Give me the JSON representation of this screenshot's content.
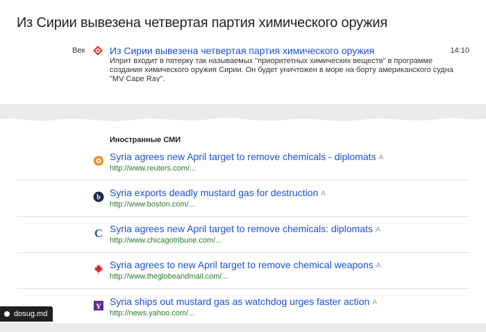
{
  "headline": "Из Сирии вывезена четвертая партия химического оружия",
  "top_item": {
    "source": "Век",
    "source_icon": "red-diamond-icon",
    "title": "Из Сирии вывезена четвертая партия химического оружия",
    "time": "14:10",
    "snippet": "Иприт входит в пятерку так называемых \"приоритетных химических веществ\" в программе создания химического оружия Сирии. Он будет уничтожен в море на борту американского судна \"MV Cape Ray\"."
  },
  "foreign": {
    "section_title": "Иностранные СМИ",
    "translate_label": "A",
    "items": [
      {
        "title": "Syria agrees new April target to remove chemicals - diplomats",
        "url": "http://www.reuters.com/...",
        "icon": "reuters-logo-icon",
        "icon_color": "#f08a24"
      },
      {
        "title": "Syria exports deadly mustard gas for destruction",
        "url": "http://www.boston.com/...",
        "icon": "boston-globe-logo-icon",
        "icon_color": "#1b2a4a"
      },
      {
        "title": "Syria agrees new April target to remove chemicals: diplomats",
        "url": "http://www.chicagotribune.com/...",
        "icon": "chicago-tribune-logo-icon",
        "icon_color": "#2c5a9a"
      },
      {
        "title": "Syria agrees to new April target to remove chemical weapons",
        "url": "http://www.theglobeandmail.com/...",
        "icon": "maple-leaf-icon",
        "icon_color": "#d8232a"
      },
      {
        "title": "Syria ships out mustard gas as watchdog urges faster action",
        "url": "http://news.yahoo.com/...",
        "icon": "yahoo-logo-icon",
        "icon_color": "#5f2d91"
      }
    ]
  },
  "watermark": "dosug.md"
}
